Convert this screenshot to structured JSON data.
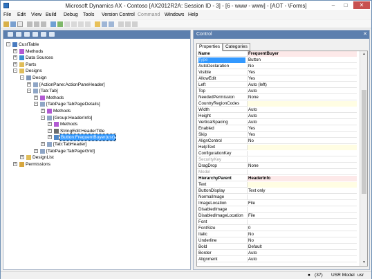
{
  "window": {
    "title": "Microsoft Dynamics AX - Contoso [AX2012R2A: Session ID - 3] - [6 - www - www] - [AOT - \\Forms]"
  },
  "menu": [
    {
      "label": "File"
    },
    {
      "label": "Edit"
    },
    {
      "label": "View"
    },
    {
      "label": "Build"
    },
    {
      "label": "Debug"
    },
    {
      "label": "Tools"
    },
    {
      "label": "Version Control"
    },
    {
      "label": "Command",
      "dim": true
    },
    {
      "label": "Windows"
    },
    {
      "label": "Help"
    }
  ],
  "tree": [
    {
      "label": "CustTable",
      "level": 0,
      "exp": "-",
      "icon": "form-icon"
    },
    {
      "label": "Methods",
      "level": 1,
      "exp": "+",
      "icon": "methods-icon"
    },
    {
      "label": "Data Sources",
      "level": 1,
      "exp": "+",
      "icon": "datasource-icon"
    },
    {
      "label": "Parts",
      "level": 1,
      "exp": "+",
      "icon": "folder-icon"
    },
    {
      "label": "Designs",
      "level": 1,
      "exp": "-",
      "icon": "folder-icon"
    },
    {
      "label": "Design",
      "level": 2,
      "exp": "-",
      "icon": "design-icon"
    },
    {
      "label": "[ActionPane:ActionPaneHeader]",
      "level": 3,
      "exp": "+",
      "icon": "control-icon"
    },
    {
      "label": "[Tab:Tab]",
      "level": 3,
      "exp": "-",
      "icon": "control-icon"
    },
    {
      "label": "Methods",
      "level": 4,
      "exp": "+",
      "icon": "methods-icon"
    },
    {
      "label": "[TabPage:TabPageDetails]",
      "level": 4,
      "exp": "-",
      "icon": "control-icon"
    },
    {
      "label": "Methods",
      "level": 5,
      "exp": "+",
      "icon": "methods-icon"
    },
    {
      "label": "[Group:HeaderInfo]",
      "level": 5,
      "exp": "-",
      "icon": "control-icon"
    },
    {
      "label": "Methods",
      "level": 6,
      "exp": "+",
      "icon": "methods-icon"
    },
    {
      "label": "StringEdit:HeaderTitle",
      "level": 6,
      "exp": "+",
      "icon": "stringedit-icon"
    },
    {
      "label": "Button:FrequentBuyer(usr)",
      "level": 6,
      "exp": "+",
      "icon": "button-icon",
      "selected": true
    },
    {
      "label": "[Tab:TabHeader]",
      "level": 5,
      "exp": "+",
      "icon": "control-icon"
    },
    {
      "label": "[TabPage:TabPageGrid]",
      "level": 4,
      "exp": "+",
      "icon": "control-icon"
    },
    {
      "label": "DesignList",
      "level": 2,
      "exp": "+",
      "icon": "folder-icon"
    },
    {
      "label": "Permissions",
      "level": 1,
      "exp": "+",
      "icon": "permissions-icon"
    }
  ],
  "properties_pane": {
    "title": "Control",
    "tabs": [
      {
        "label": "Properties",
        "active": true
      },
      {
        "label": "Categories"
      }
    ],
    "rows": [
      {
        "name": "Name",
        "value": "FrequentBuyer",
        "hdr": true
      },
      {
        "name": "Type",
        "value": "Button",
        "selname": true
      },
      {
        "name": "AutoDeclaration",
        "value": "No"
      },
      {
        "name": "Visible",
        "value": "Yes"
      },
      {
        "name": "AllowEdit",
        "value": "Yes"
      },
      {
        "name": "Left",
        "value": "Auto (left)"
      },
      {
        "name": "Top",
        "value": "Auto"
      },
      {
        "name": "NeededPermission",
        "value": "None"
      },
      {
        "name": "CountryRegionCodes",
        "value": "",
        "yellow": true
      },
      {
        "name": "Width",
        "value": "Auto"
      },
      {
        "name": "Height",
        "value": "Auto"
      },
      {
        "name": "VerticalSpacing",
        "value": "Auto"
      },
      {
        "name": "Enabled",
        "value": "Yes"
      },
      {
        "name": "Skip",
        "value": "Yes"
      },
      {
        "name": "AlignControl",
        "value": "No"
      },
      {
        "name": "HelpText",
        "value": "",
        "yellow": true
      },
      {
        "name": "ConfigurationKey",
        "value": ""
      },
      {
        "name": "SecurityKey",
        "value": "",
        "dim": true
      },
      {
        "name": "DragDrop",
        "value": "None"
      },
      {
        "name": "Model",
        "value": "",
        "dim": true
      },
      {
        "name": "HierarchyParent",
        "value": "HeaderInfo",
        "hdr": true
      },
      {
        "name": "Text",
        "value": "",
        "yellow": true
      },
      {
        "name": "ButtonDisplay",
        "value": "Text only"
      },
      {
        "name": "NormalImage",
        "value": ""
      },
      {
        "name": "ImageLocation",
        "value": "File"
      },
      {
        "name": "DisabledImage",
        "value": ""
      },
      {
        "name": "DisabledImageLocation",
        "value": "File"
      },
      {
        "name": "Font",
        "value": ""
      },
      {
        "name": "FontSize",
        "value": "0"
      },
      {
        "name": "Italic",
        "value": "No"
      },
      {
        "name": "Underline",
        "value": "No"
      },
      {
        "name": "Bold",
        "value": "Default"
      },
      {
        "name": "Border",
        "value": "Auto"
      },
      {
        "name": "Alignment",
        "value": "Auto"
      }
    ]
  },
  "status": {
    "count": "(37)",
    "layer": "USR Model",
    "user": "usr"
  }
}
